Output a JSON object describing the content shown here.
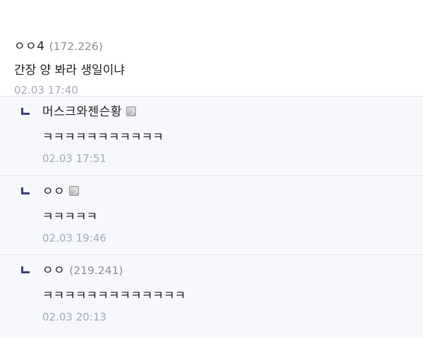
{
  "comment": {
    "nick": "ㅇㅇ4",
    "ip": "(172.226)",
    "text": "간장 양 봐라 생일이냐",
    "date": "02.03 17:40"
  },
  "replies": [
    {
      "nick": "머스크와젠슨황",
      "ip": "",
      "has_gallog_icon": true,
      "text": "ㅋㅋㅋㅋㅋㅋㅋㅋㅋㅋㅋ",
      "date": "02.03 17:51"
    },
    {
      "nick": "ㅇㅇ",
      "ip": "",
      "has_gallog_icon": true,
      "text": "ㅋㅋㅋㅋㅋ",
      "date": "02.03 19:46"
    },
    {
      "nick": "ㅇㅇ",
      "ip": "(219.241)",
      "has_gallog_icon": false,
      "text": "ㅋㅋㅋㅋㅋㅋㅋㅋㅋㅋㅋㅋㅋ",
      "date": "02.03 20:13"
    }
  ],
  "icons": {
    "reply": "reply-arrow-icon",
    "gallog": "gallog-icon"
  },
  "colors": {
    "reply_bg": "#f7f8fc",
    "date": "#a3a9bd",
    "ip": "#8f8f8f",
    "reply_arrow": "#3d3f75"
  }
}
